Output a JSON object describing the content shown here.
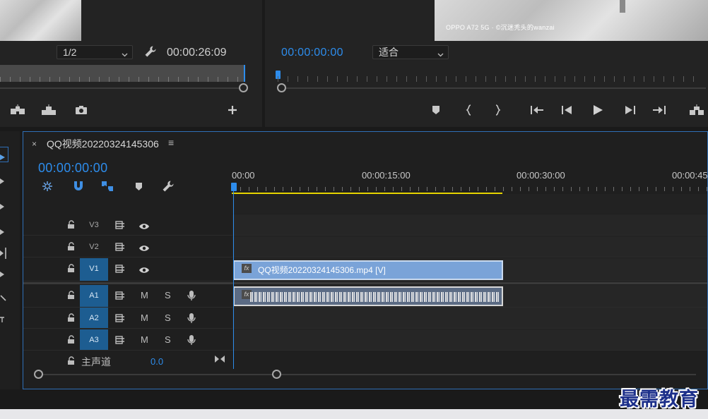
{
  "source_monitor": {
    "resolution": "1/2",
    "timecode": "00:00:26:09"
  },
  "program_monitor": {
    "watermark": "OPPO A72 5G · ©沉迷秃头的wanzai",
    "timecode": "00:00:00:00",
    "fit": "适合"
  },
  "timeline": {
    "close_glyph": "×",
    "sequence_name": "QQ视频20220324145306",
    "menu_glyph": "≡",
    "timecode": "00:00:00:00",
    "ruler_labels": [
      "00:00",
      "00:00:15:00",
      "00:00:30:00",
      "00:00:45"
    ],
    "tracks": {
      "v3": "V3",
      "v2": "V2",
      "v1": "V1",
      "a1": "A1",
      "a2": "A2",
      "a3": "A3"
    },
    "mute_label": "M",
    "solo_label": "S",
    "video_clip": {
      "fx": "fx",
      "label": "QQ视频20220324145306.mp4 [V]"
    },
    "audio_clip": {
      "fx": "fx"
    },
    "master": {
      "label": "主声道",
      "value": "0.0"
    }
  },
  "brand": "最需教育",
  "colors": {
    "accent": "#2d8ceb",
    "active_track": "#1d5d91",
    "video_clip": "#7aa3d8",
    "audio_clip": "#5b6b84",
    "work_area": "#e6d400"
  }
}
